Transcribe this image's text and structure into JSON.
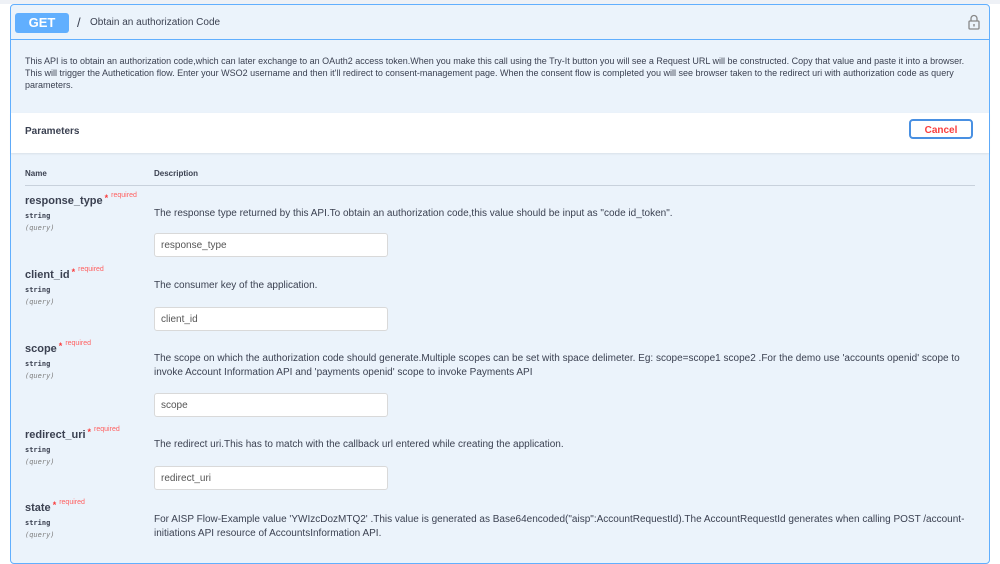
{
  "operation": {
    "method": "GET",
    "separator": "/",
    "summary": "Obtain an authorization Code",
    "description": "This API is to obtain an authorization code,which can later exchange to an OAuth2 access token.When you make this call using the Try-It button you will see a Request URL will be constructed. Copy that value and paste it into a browser. This will trigger the Authetication flow. Enter your WSO2 username and then it'll redirect to consent-management page. When the consent flow is completed you will see browser taken to the redirect uri with authorization code as query parameters."
  },
  "parameters": {
    "title": "Parameters",
    "cancel_label": "Cancel",
    "col_name": "Name",
    "col_description": "Description",
    "required_label": "required",
    "required_star": "*",
    "items": [
      {
        "name": "response_type",
        "type": "string",
        "in": "(query)",
        "description": "The response type returned by this API.To obtain an authorization code,this value should be input as \"code id_token\".",
        "placeholder": "response_type"
      },
      {
        "name": "client_id",
        "type": "string",
        "in": "(query)",
        "description": "The consumer key of the application.",
        "placeholder": "client_id"
      },
      {
        "name": "scope",
        "type": "string",
        "in": "(query)",
        "description": "The scope on which the authorization code should generate.Multiple scopes can be set with space delimeter. Eg: scope=scope1 scope2 .For the demo use 'accounts openid' scope to invoke Account Information API and 'payments openid' scope to invoke Payments API",
        "placeholder": "scope"
      },
      {
        "name": "redirect_uri",
        "type": "string",
        "in": "(query)",
        "description": "The redirect uri.This has to match with the callback url entered while creating the application.",
        "placeholder": "redirect_uri"
      },
      {
        "name": "state",
        "type": "string",
        "in": "(query)",
        "description": "For AISP Flow-Example value 'YWIzcDozMTQ2' .This value is generated as Base64encoded(\"aisp\":AccountRequestId).The AccountRequestId generates when calling POST /account-initiations API resource of AccountsInformation API."
      }
    ]
  },
  "icons": {
    "lock": "lock-icon"
  },
  "colors": {
    "get": "#61affe",
    "required": "#f93e3e",
    "cancel_border": "#4990e2",
    "block_bg": "#ebf3fb"
  }
}
